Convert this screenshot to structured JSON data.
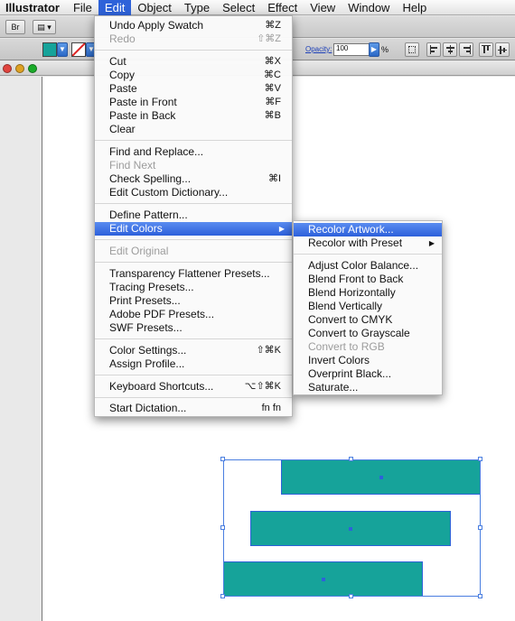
{
  "menubar": {
    "app": "Illustrator",
    "items": [
      "File",
      "Edit",
      "Object",
      "Type",
      "Select",
      "Effect",
      "View",
      "Window",
      "Help"
    ]
  },
  "appbar": {
    "bridge_label": "Br"
  },
  "controlbar": {
    "fill_color": "#16a39a",
    "opacity_label": "Opacity:",
    "opacity_value": "100",
    "percent_sign": "%"
  },
  "edit_menu": {
    "undo": {
      "label": "Undo Apply Swatch",
      "shortcut": "⌘Z"
    },
    "redo": {
      "label": "Redo",
      "shortcut": "⇧⌘Z"
    },
    "cut": {
      "label": "Cut",
      "shortcut": "⌘X"
    },
    "copy": {
      "label": "Copy",
      "shortcut": "⌘C"
    },
    "paste": {
      "label": "Paste",
      "shortcut": "⌘V"
    },
    "paste_front": {
      "label": "Paste in Front",
      "shortcut": "⌘F"
    },
    "paste_back": {
      "label": "Paste in Back",
      "shortcut": "⌘B"
    },
    "clear": {
      "label": "Clear"
    },
    "find_replace": {
      "label": "Find and Replace..."
    },
    "find_next": {
      "label": "Find Next"
    },
    "check_spelling": {
      "label": "Check Spelling...",
      "shortcut": "⌘I"
    },
    "edit_dictionary": {
      "label": "Edit Custom Dictionary..."
    },
    "define_pattern": {
      "label": "Define Pattern..."
    },
    "edit_colors": {
      "label": "Edit Colors",
      "arrow": "▶"
    },
    "edit_original": {
      "label": "Edit Original"
    },
    "transparency_presets": {
      "label": "Transparency Flattener Presets..."
    },
    "tracing_presets": {
      "label": "Tracing Presets..."
    },
    "print_presets": {
      "label": "Print Presets..."
    },
    "pdf_presets": {
      "label": "Adobe PDF Presets..."
    },
    "swf_presets": {
      "label": "SWF Presets..."
    },
    "color_settings": {
      "label": "Color Settings...",
      "shortcut": "⇧⌘K"
    },
    "assign_profile": {
      "label": "Assign Profile..."
    },
    "keyboard_shortcuts": {
      "label": "Keyboard Shortcuts...",
      "shortcut": "⌥⇧⌘K"
    },
    "start_dictation": {
      "label": "Start Dictation...",
      "shortcut": "fn fn"
    }
  },
  "recolor_menu": {
    "recolor_artwork": {
      "label": "Recolor Artwork..."
    },
    "recolor_preset": {
      "label": "Recolor with Preset",
      "arrow": "▶"
    },
    "adjust_balance": {
      "label": "Adjust Color Balance..."
    },
    "blend_front_back": {
      "label": "Blend Front to Back"
    },
    "blend_horizontal": {
      "label": "Blend Horizontally"
    },
    "blend_vertical": {
      "label": "Blend Vertically"
    },
    "to_cmyk": {
      "label": "Convert to CMYK"
    },
    "to_grayscale": {
      "label": "Convert to Grayscale"
    },
    "to_rgb": {
      "label": "Convert to RGB"
    },
    "invert": {
      "label": "Invert Colors"
    },
    "overprint_black": {
      "label": "Overprint Black..."
    },
    "saturate": {
      "label": "Saturate..."
    }
  },
  "colors": {
    "highlight": "#2e62d9",
    "artwork_fill": "#16a39a",
    "selection": "#4a7ee0"
  }
}
